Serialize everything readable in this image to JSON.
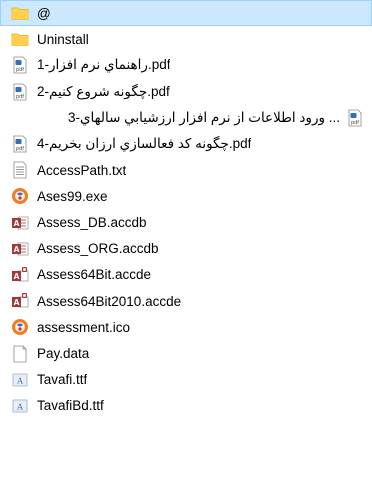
{
  "files": [
    {
      "name": "@",
      "icon": "folder-icon",
      "selected": true
    },
    {
      "name": "Uninstall",
      "icon": "folder-icon",
      "selected": false
    },
    {
      "name": "راهنماي نرم افزار-1.pdf",
      "icon": "pdf-icon",
      "selected": false
    },
    {
      "name": "چگونه شروع کنيم-2.pdf",
      "icon": "pdf-icon",
      "selected": false
    },
    {
      "name": "ورود اطلاعات از نرم افزار ارزشيابي سالهاي-3 ...",
      "icon": "pdf-icon",
      "selected": false
    },
    {
      "name": "چگونه کد فعالسازي ارزان بخريم-4.pdf",
      "icon": "pdf-icon",
      "selected": false
    },
    {
      "name": "AccessPath.txt",
      "icon": "text-file-icon",
      "selected": false
    },
    {
      "name": "Ases99.exe",
      "icon": "app-exe-icon",
      "selected": false
    },
    {
      "name": "Assess_DB.accdb",
      "icon": "access-db-icon",
      "selected": false
    },
    {
      "name": "Assess_ORG.accdb",
      "icon": "access-db-icon",
      "selected": false
    },
    {
      "name": "Assess64Bit.accde",
      "icon": "access-accde-icon",
      "selected": false
    },
    {
      "name": "Assess64Bit2010.accde",
      "icon": "access-accde-icon",
      "selected": false
    },
    {
      "name": "assessment.ico",
      "icon": "ico-file-icon",
      "selected": false
    },
    {
      "name": "Pay.data",
      "icon": "blank-file-icon",
      "selected": false
    },
    {
      "name": "Tavafi.ttf",
      "icon": "font-file-icon",
      "selected": false
    },
    {
      "name": "TavafiBd.ttf",
      "icon": "font-file-icon",
      "selected": false
    }
  ],
  "colors": {
    "selection_bg": "#cce8ff",
    "selection_border": "#99d1ff",
    "folder_yellow": "#ffd766",
    "access_red": "#a4373a",
    "ico_orange": "#f07c22"
  }
}
